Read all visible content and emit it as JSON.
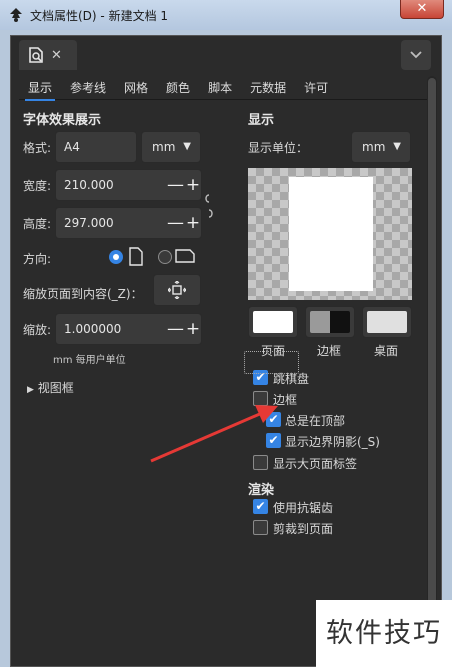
{
  "window": {
    "title": "文档属性(D) - 新建文档 1",
    "close_glyph": "✕"
  },
  "doc_tab": {
    "close_glyph": "✕"
  },
  "tabs": [
    {
      "label": "显示",
      "active": true
    },
    {
      "label": "参考线"
    },
    {
      "label": "网格"
    },
    {
      "label": "颜色"
    },
    {
      "label": "脚本"
    },
    {
      "label": "元数据"
    },
    {
      "label": "许可"
    }
  ],
  "left": {
    "section_title": "字体效果展示",
    "format": {
      "label": "格式:",
      "value": "A4",
      "unit": "mm"
    },
    "width": {
      "label": "宽度:",
      "value": "210.000"
    },
    "height": {
      "label": "高度:",
      "value": "297.000"
    },
    "orientation": {
      "label": "方向:",
      "selected": "portrait"
    },
    "resize_label": "缩放页面到内容(_Z)：",
    "scale": {
      "label": "缩放:",
      "value": "1.000000"
    },
    "unit_note": "mm 每用户单位",
    "viewbox_label": "视图框",
    "spin_minus": "—",
    "spin_plus": "+"
  },
  "right": {
    "section_title": "显示",
    "display_unit_label": "显示单位：",
    "display_unit": "mm",
    "swatches": [
      {
        "label": "页面",
        "color": "#ffffff"
      },
      {
        "label": "边框",
        "color": "#555555"
      },
      {
        "label": "桌面",
        "color": "#e0e0e0"
      }
    ],
    "checkboxes": {
      "checkerboard": {
        "label": "跳棋盘",
        "checked": true
      },
      "border": {
        "label": "边框",
        "checked": false
      },
      "border_on_top": {
        "label": "总是在顶部",
        "checked": true
      },
      "border_shadow": {
        "label": "显示边界阴影(_S)",
        "checked": true
      },
      "page_label": {
        "label": "显示大页面标签",
        "checked": false
      }
    },
    "render_title": "渲染",
    "render_checkboxes": {
      "antialias": {
        "label": "使用抗锯齿",
        "checked": true
      },
      "clip": {
        "label": "剪裁到页面",
        "checked": false
      }
    }
  },
  "watermark": "软件技巧",
  "colors": {
    "accent": "#3584e4",
    "panel_bg": "#2b2b2b",
    "arrow": "#e53935"
  }
}
